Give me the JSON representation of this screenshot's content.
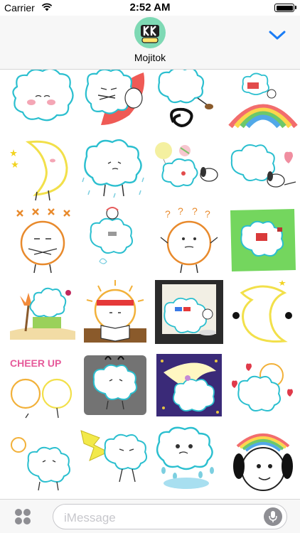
{
  "status_bar": {
    "carrier": "Carrier",
    "time": "2:52 AM",
    "battery_level": 1.0
  },
  "header": {
    "app_name": "Mojitok",
    "collapse_icon": "chevron-down-icon",
    "accent": "#1a7cf5"
  },
  "stickers": [
    "cloud-blushing",
    "cloud-arms-crossed-heart",
    "cloud-kicking-swirl",
    "cloud-on-rainbow",
    "moon-smiling-stars",
    "cloud-in-rain",
    "cloud-with-balloon-and-dog",
    "cloud-with-heart-and-dog",
    "sun-arms-crossed-annoyed",
    "cloud-with-bear",
    "sun-question-marks",
    "cloud-reading-on-grass",
    "cloud-in-hawaii",
    "sun-studying-headband",
    "cloud-3d-glasses-movie",
    "moon-with-stars",
    "sun-cheer-up",
    "cloud-gray-stressed",
    "cloud-on-moon-night",
    "cloud-sun-hearts",
    "cloud-with-sun-arguing",
    "cloud-lightning-angry",
    "cloud-crying-puddle",
    "dog-rainbow-hair"
  ],
  "cheer_text": "CHEER UP",
  "input": {
    "placeholder": "iMessage",
    "apps_icon": "app-drawer-icon",
    "mic_icon": "microphone-icon"
  }
}
